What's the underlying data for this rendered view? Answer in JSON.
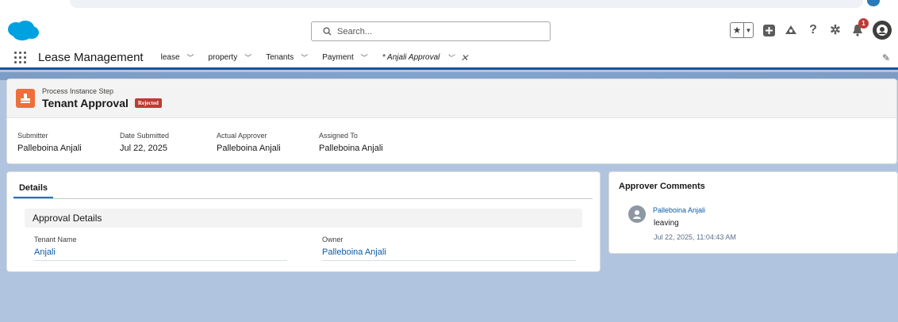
{
  "header": {
    "search_placeholder": "Search...",
    "notification_count": "1"
  },
  "nav": {
    "app_name": "Lease Management",
    "items": [
      {
        "label": "lease"
      },
      {
        "label": "property"
      },
      {
        "label": "Tenants"
      },
      {
        "label": "Payment"
      }
    ],
    "active_tab": "* Anjali Approval"
  },
  "record": {
    "entity_label": "Process Instance Step",
    "title": "Tenant Approval",
    "status": "Rejected",
    "fields": [
      {
        "label": "Submitter",
        "value": "Palleboina Anjali"
      },
      {
        "label": "Date Submitted",
        "value": "Jul 22, 2025"
      },
      {
        "label": "Actual Approver",
        "value": "Palleboina Anjali"
      },
      {
        "label": "Assigned To",
        "value": "Palleboina Anjali"
      }
    ]
  },
  "details": {
    "tab_label": "Details",
    "section_title": "Approval Details",
    "tenant_name_label": "Tenant Name",
    "tenant_name_value": "Anjali",
    "owner_label": "Owner",
    "owner_value": "Palleboina Anjali"
  },
  "comments": {
    "title": "Approver Comments",
    "user": "Palleboina Anjali",
    "text": "leaving",
    "timestamp": "Jul 22, 2025, 11:04:43 AM"
  },
  "colors": {
    "brand_blue": "#1b5297",
    "link": "#0b5cab",
    "record_icon": "#ef6e3a",
    "status_rejected": "#c23934",
    "page_bg": "#b0c4df"
  }
}
